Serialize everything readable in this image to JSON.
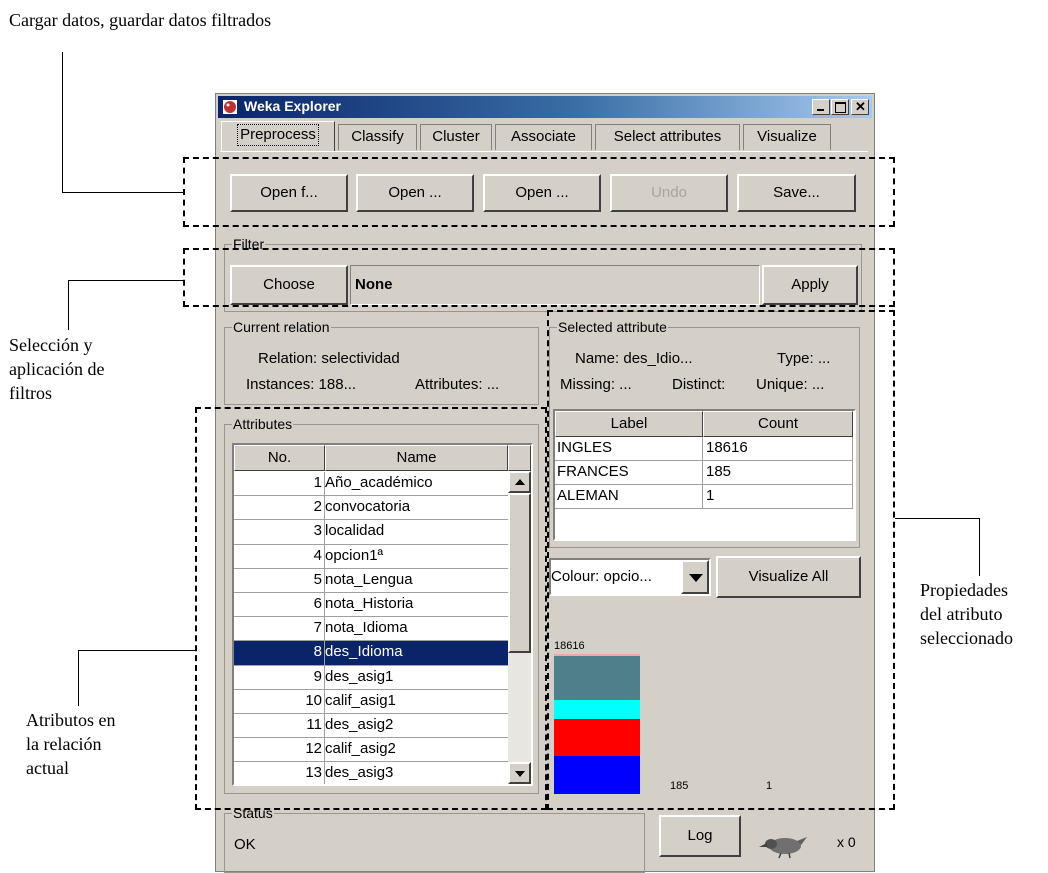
{
  "annotations": {
    "top": "Cargar datos, guardar datos filtrados",
    "filter": [
      "Selección  y",
      "aplicación de",
      "filtros"
    ],
    "attributes": [
      "Atributos en",
      "la relación",
      "actual"
    ],
    "properties": [
      "Propiedades",
      "del atributo",
      "seleccionado"
    ]
  },
  "window": {
    "title": "Weka Explorer"
  },
  "tabs": [
    {
      "label": "Preprocess",
      "active": true
    },
    {
      "label": "Classify"
    },
    {
      "label": "Cluster"
    },
    {
      "label": "Associate"
    },
    {
      "label": "Select attributes"
    },
    {
      "label": "Visualize"
    }
  ],
  "toolbar": {
    "open_file": "Open f...",
    "open_url": "Open ...",
    "open_db": "Open ...",
    "undo": "Undo",
    "save": "Save..."
  },
  "filter": {
    "group_label": "Filter",
    "choose": "Choose",
    "value": "None",
    "apply": "Apply"
  },
  "relation": {
    "group_label": "Current relation",
    "relation": "Relation: selectividad",
    "instances": "Instances: 188...",
    "attributes": "Attributes: ..."
  },
  "attributes": {
    "group_label": "Attributes",
    "col_no": "No.",
    "col_name": "Name",
    "rows": [
      {
        "no": "1",
        "name": "Año_académico"
      },
      {
        "no": "2",
        "name": "convocatoria"
      },
      {
        "no": "3",
        "name": "localidad"
      },
      {
        "no": "4",
        "name": "opcion1ª"
      },
      {
        "no": "5",
        "name": "nota_Lengua"
      },
      {
        "no": "6",
        "name": "nota_Historia"
      },
      {
        "no": "7",
        "name": "nota_Idioma"
      },
      {
        "no": "8",
        "name": "des_Idioma",
        "selected": true
      },
      {
        "no": "9",
        "name": "des_asig1"
      },
      {
        "no": "10",
        "name": "calif_asig1"
      },
      {
        "no": "11",
        "name": "des_asig2"
      },
      {
        "no": "12",
        "name": "calif_asig2"
      },
      {
        "no": "13",
        "name": "des_asig3"
      }
    ]
  },
  "selected": {
    "group_label": "Selected attribute",
    "name": "Name: des_Idio...",
    "type": "Type: ...",
    "missing": "Missing: ...",
    "distinct": "Distinct:",
    "unique": "Unique: ...",
    "col_label": "Label",
    "col_count": "Count",
    "rows": [
      {
        "label": "INGLES",
        "count": "18616"
      },
      {
        "label": "FRANCES",
        "count": "185"
      },
      {
        "label": "ALEMAN",
        "count": "1"
      }
    ]
  },
  "colour": {
    "select": "Colour: opcio...",
    "visualize_all": "Visualize All"
  },
  "histogram": {
    "bars": [
      {
        "value": 18616,
        "label": "18616"
      },
      {
        "value": 185,
        "label": "185"
      },
      {
        "value": 1,
        "label": "1"
      }
    ],
    "colors": [
      "#f4a6a6",
      "#4f7f8a",
      "#00ffff",
      "#ff0000",
      "#0000ff"
    ]
  },
  "status": {
    "group_label": "Status",
    "text": "OK",
    "log": "Log",
    "count": "x 0"
  }
}
